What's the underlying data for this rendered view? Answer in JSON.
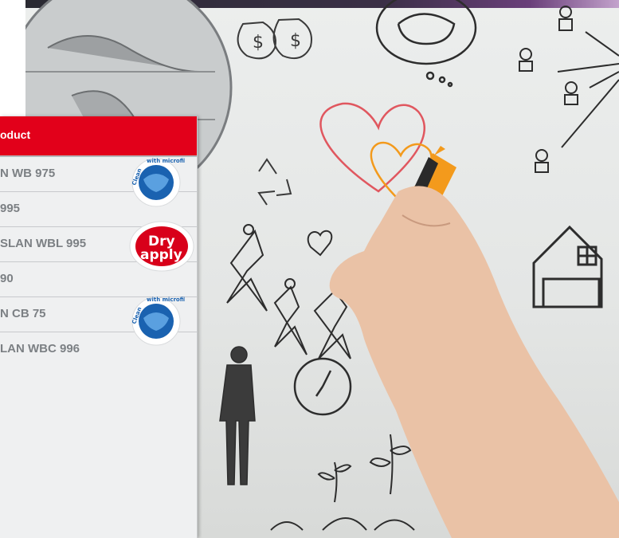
{
  "table": {
    "header": "oduct",
    "rows": [
      {
        "label": "N WB 975",
        "badge": "microfiber"
      },
      {
        "label": "995",
        "badge": null
      },
      {
        "label": "SLAN WBL 995",
        "badge": "dry-apply"
      },
      {
        "label": "90",
        "badge": null
      },
      {
        "label": "N CB 75",
        "badge": "microfiber"
      },
      {
        "label": "LAN WBC 996",
        "badge": null
      }
    ]
  },
  "badges": {
    "microfiber": {
      "line1": "Clean",
      "line2": "with microfiber cloth"
    },
    "dry_apply": {
      "line1": "Dry",
      "line2": "apply"
    }
  },
  "colors": {
    "header_red": "#e2001a",
    "badge_blue": "#1a62b0",
    "badge_red": "#d8001a",
    "marker_orange": "#f39a1c"
  }
}
